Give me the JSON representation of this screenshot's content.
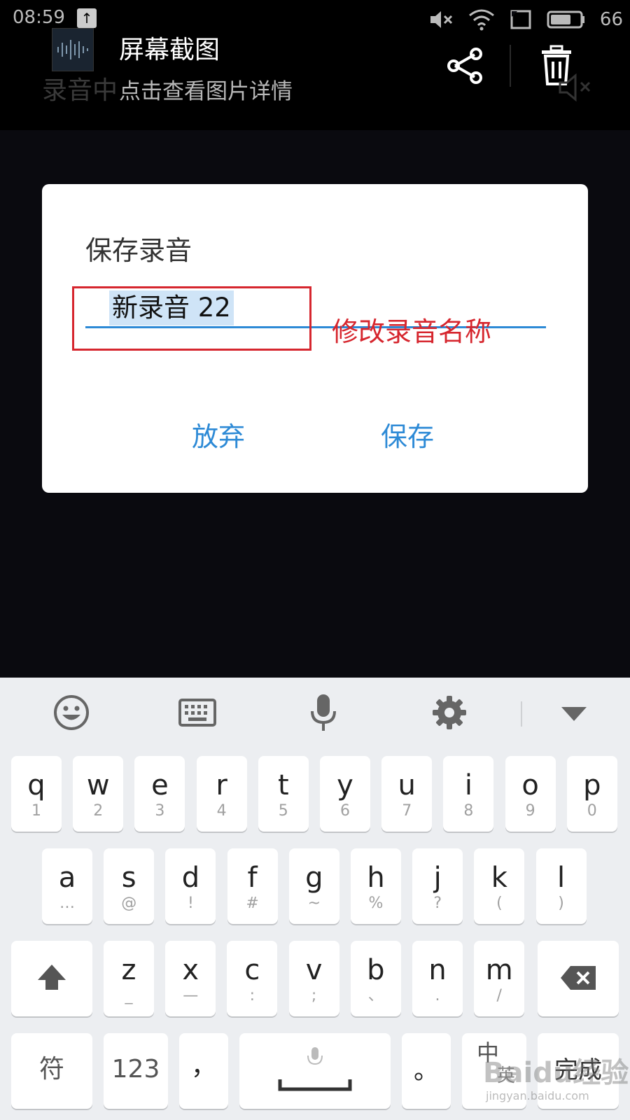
{
  "status_bar": {
    "time": "08:59",
    "battery": "66"
  },
  "notification": {
    "background_text": "录音中",
    "title": "屏幕截图",
    "subtitle": "点击查看图片详情",
    "icons": [
      "upload-icon",
      "mute-icon",
      "wifi-icon",
      "sim-icon",
      "battery-icon",
      "share-icon",
      "trash-icon"
    ]
  },
  "dialog": {
    "title": "保存录音",
    "input_value": "新录音 22",
    "annotation": "修改录音名称",
    "discard_label": "放弃",
    "save_label": "保存",
    "accent_color": "#2d8ad6",
    "annotation_color": "#d6262e"
  },
  "keyboard": {
    "toolbar_icons": [
      "emoji-icon",
      "keyboard-icon",
      "microphone-icon",
      "gear-icon",
      "chevron-down-icon"
    ],
    "row1": [
      {
        "k": "q",
        "s": "1"
      },
      {
        "k": "w",
        "s": "2"
      },
      {
        "k": "e",
        "s": "3"
      },
      {
        "k": "r",
        "s": "4"
      },
      {
        "k": "t",
        "s": "5"
      },
      {
        "k": "y",
        "s": "6"
      },
      {
        "k": "u",
        "s": "7"
      },
      {
        "k": "i",
        "s": "8"
      },
      {
        "k": "o",
        "s": "9"
      },
      {
        "k": "p",
        "s": "0"
      }
    ],
    "row2": [
      {
        "k": "a",
        "s": "…"
      },
      {
        "k": "s",
        "s": "@"
      },
      {
        "k": "d",
        "s": "!"
      },
      {
        "k": "f",
        "s": "#"
      },
      {
        "k": "g",
        "s": "~"
      },
      {
        "k": "h",
        "s": "%"
      },
      {
        "k": "j",
        "s": "?"
      },
      {
        "k": "k",
        "s": "("
      },
      {
        "k": "l",
        "s": ")"
      }
    ],
    "row3": [
      {
        "k": "z",
        "s": "_"
      },
      {
        "k": "x",
        "s": "—"
      },
      {
        "k": "c",
        "s": ":"
      },
      {
        "k": "v",
        "s": ";"
      },
      {
        "k": "b",
        "s": "、"
      },
      {
        "k": "n",
        "s": "."
      },
      {
        "k": "m",
        "s": "/"
      }
    ],
    "bottom": {
      "symbols": "符",
      "numbers": "123",
      "comma": "，",
      "period": "。",
      "lang": "中",
      "lang_sub": "英",
      "done": "完成"
    }
  },
  "watermark": {
    "text": "Baidu经验",
    "url": "jingyan.baidu.com"
  }
}
